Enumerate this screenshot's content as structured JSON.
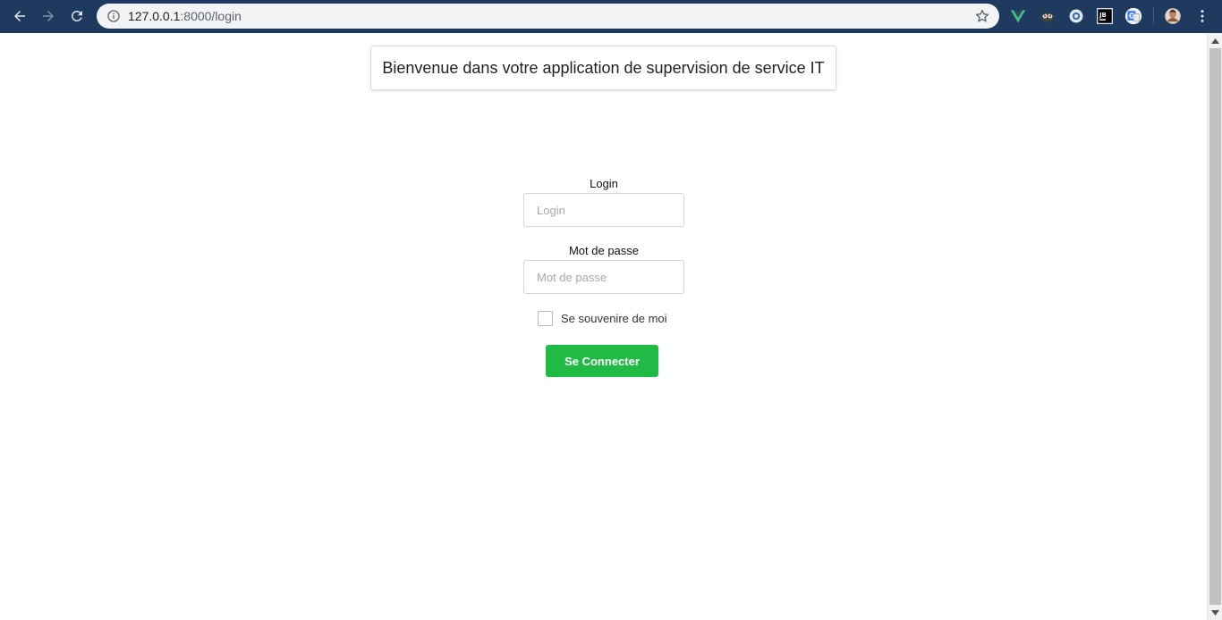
{
  "browser": {
    "url_host": "127.0.0.1",
    "url_rest": ":8000/login",
    "toolbar_color": "#1e3a5f",
    "icons": [
      "back-icon",
      "forward-icon",
      "reload-icon",
      "info-icon",
      "bookmark-star-icon",
      "vue-devtools-icon",
      "extension-owl-icon",
      "extension-circle-icon",
      "jetbrains-icon",
      "google-translate-icon",
      "profile-avatar-icon",
      "menu-dots-icon"
    ]
  },
  "header": {
    "title": "Bienvenue dans votre application de supervision de service IT"
  },
  "login_form": {
    "login_label": "Login",
    "login_placeholder": "Login",
    "login_value": "",
    "password_label": "Mot de passe",
    "password_placeholder": "Mot de passe",
    "password_value": "",
    "remember_label": "Se souvenire de moi",
    "remember_checked": false,
    "submit_label": "Se Connecter",
    "submit_color": "#21ba45"
  }
}
